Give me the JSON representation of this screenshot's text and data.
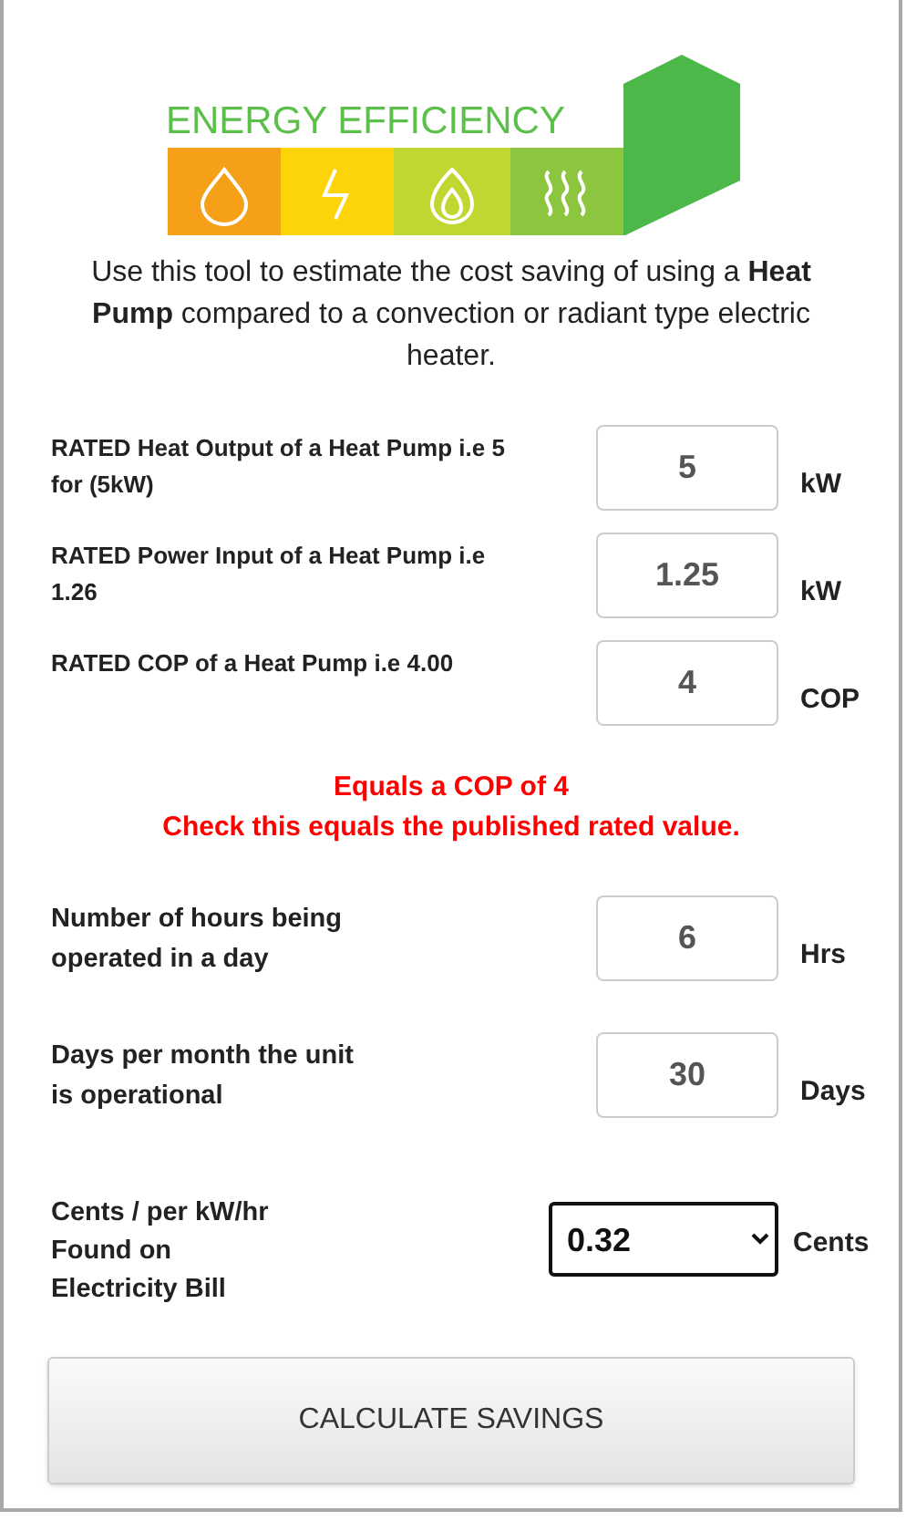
{
  "logo": {
    "title": "ENERGY EFFICIENCY"
  },
  "intro": "Use this tool to estimate the cost saving of using a **Heat Pump**  compared to a convection or radiant type electric heater.",
  "rated_inputs": [
    {
      "kind": "input",
      "label": "RATED Heat Output of a Heat Pump i.e 5 for (5kW)",
      "value": "5",
      "unit": "kW"
    },
    {
      "kind": "input",
      "label": "RATED  Power Input of a Heat Pump  i.e 1.26",
      "value": "1.25",
      "unit": "kW"
    },
    {
      "kind": "input",
      "label": "RATED  COP of a Heat Pump i.e 4.00",
      "value": "4",
      "unit": "COP"
    }
  ],
  "notice": [
    "Equals a COP of 4",
    "Check this equals the published rated value."
  ],
  "usage_inputs": [
    {
      "kind": "input",
      "label": "Number of hours being operated in a day",
      "value": "6",
      "unit": "Hrs"
    },
    {
      "kind": "input",
      "label": "Days per month the unit is operational",
      "value": "30",
      "unit": "Days"
    },
    {
      "kind": "select",
      "label": "Cents / per kW/hr Found on Electricity Bill",
      "value": "0.32",
      "unit": "Cents"
    }
  ],
  "button": "CALCULATE SAVINGS"
}
